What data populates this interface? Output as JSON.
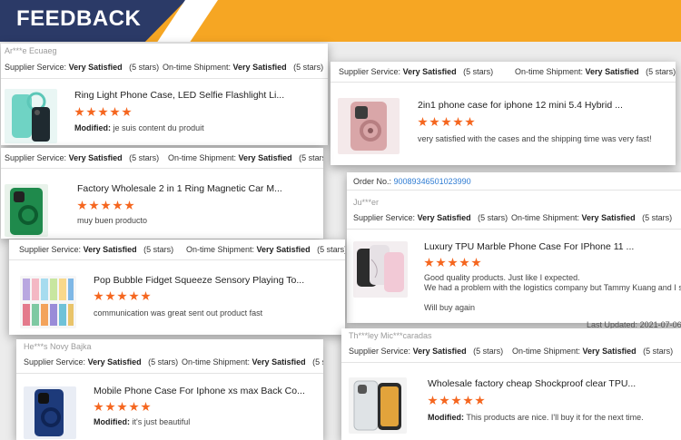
{
  "header": {
    "title": "FEEDBACK"
  },
  "supplier_label": "Supplier Service:",
  "shipment_label": "On-time Shipment:",
  "rating_text": "Very Satisfied",
  "stars_text": "(5 stars)",
  "modified_label": "Modified:",
  "cards": [
    {
      "ghost": "Ar***e Ecuaeg",
      "title": "Ring Light Phone Case, LED Selfie Flashlight Li...",
      "comment": "je suis content du produit",
      "modified": true
    },
    {
      "title": "2in1 phone case for iphone 12 mini 5.4 Hybrid ...",
      "comment": "very satisfied with the cases and the shipping time was very fast!"
    },
    {
      "title": "Factory Wholesale 2 in 1 Ring Magnetic Car M...",
      "comment": "muy buen producto"
    },
    {
      "order_label": "Order No.:",
      "order_no": "90089346501023990",
      "ghost": "Ju***er",
      "title": "Luxury TPU Marble Phone Case For IPhone 11 ...",
      "comment_lines": [
        "Good quality products. Just like I expected.",
        "We had a problem with the logistics company but Tammy Kuang and I solved it"
      ],
      "followup": "Will buy again",
      "updated_label": "Last Updated:",
      "updated": "2021-07-06 01:"
    },
    {
      "title": "Pop Bubble Fidget Squeeze Sensory Playing To...",
      "comment": "communication was great sent out product fast"
    },
    {
      "ghost": "He***s Novy Bajka",
      "title": "Mobile Phone Case For Iphone xs max Back Co...",
      "comment": "it's just beautiful",
      "modified": true
    },
    {
      "ghost": "Th***ley Mic***caradas",
      "title": "Wholesale factory cheap Shockproof clear TPU...",
      "comment": "This products are nice. I'll buy it for the next time.",
      "modified": true
    }
  ],
  "colors": {
    "banner": "#f6a623",
    "navy": "#2b3a67",
    "star": "#f5661f",
    "link": "#2d7bd3"
  }
}
